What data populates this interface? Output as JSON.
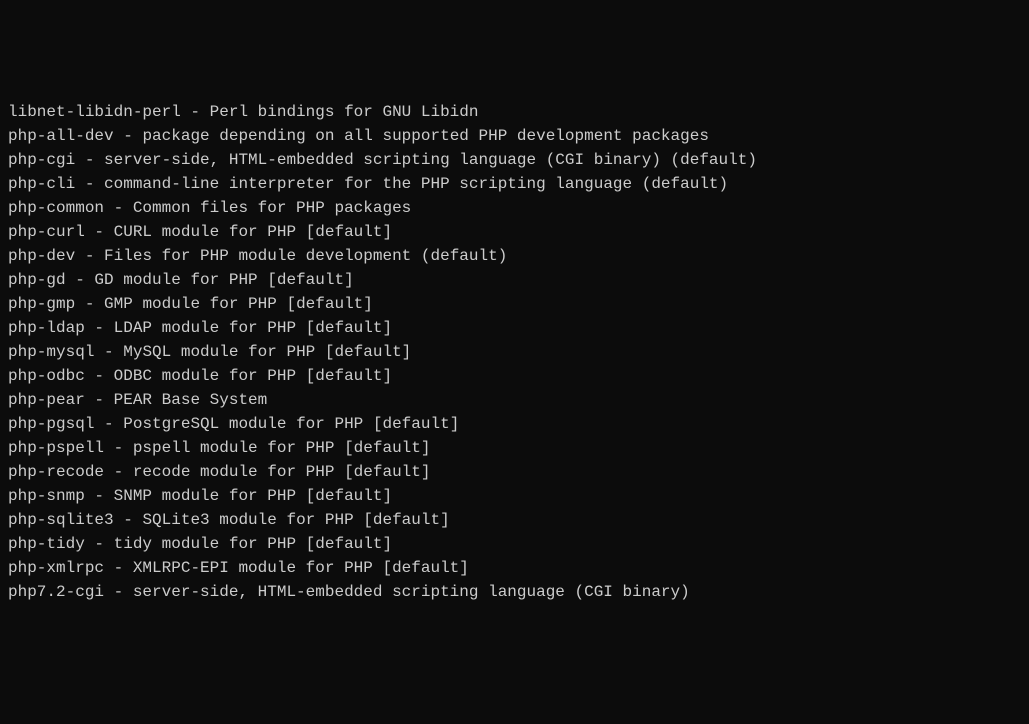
{
  "packages": [
    {
      "name": "libnet-libidn-perl",
      "description": "Perl bindings for GNU Libidn"
    },
    {
      "name": "php-all-dev",
      "description": "package depending on all supported PHP development packages"
    },
    {
      "name": "php-cgi",
      "description": "server-side, HTML-embedded scripting language (CGI binary) (default)"
    },
    {
      "name": "php-cli",
      "description": "command-line interpreter for the PHP scripting language (default)"
    },
    {
      "name": "php-common",
      "description": "Common files for PHP packages"
    },
    {
      "name": "php-curl",
      "description": "CURL module for PHP [default]"
    },
    {
      "name": "php-dev",
      "description": "Files for PHP module development (default)"
    },
    {
      "name": "php-gd",
      "description": "GD module for PHP [default]"
    },
    {
      "name": "php-gmp",
      "description": "GMP module for PHP [default]"
    },
    {
      "name": "php-ldap",
      "description": "LDAP module for PHP [default]"
    },
    {
      "name": "php-mysql",
      "description": "MySQL module for PHP [default]"
    },
    {
      "name": "php-odbc",
      "description": "ODBC module for PHP [default]"
    },
    {
      "name": "php-pear",
      "description": "PEAR Base System"
    },
    {
      "name": "php-pgsql",
      "description": "PostgreSQL module for PHP [default]"
    },
    {
      "name": "php-pspell",
      "description": "pspell module for PHP [default]"
    },
    {
      "name": "php-recode",
      "description": "recode module for PHP [default]"
    },
    {
      "name": "php-snmp",
      "description": "SNMP module for PHP [default]"
    },
    {
      "name": "php-sqlite3",
      "description": "SQLite3 module for PHP [default]"
    },
    {
      "name": "php-tidy",
      "description": "tidy module for PHP [default]"
    },
    {
      "name": "php-xmlrpc",
      "description": "XMLRPC-EPI module for PHP [default]"
    },
    {
      "name": "php7.2-cgi",
      "description": "server-side, HTML-embedded scripting language (CGI binary)"
    }
  ],
  "separator": " - "
}
